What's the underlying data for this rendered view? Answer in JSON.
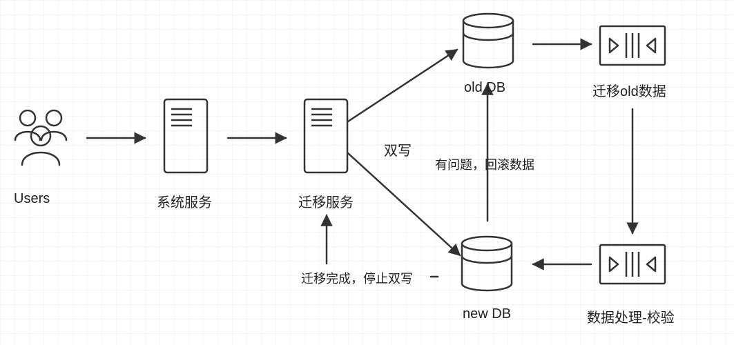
{
  "nodes": {
    "users": {
      "label": "Users"
    },
    "system_service": {
      "label": "系统服务"
    },
    "migration_service": {
      "label": "迁移服务"
    },
    "old_db": {
      "label": "old  DB"
    },
    "new_db": {
      "label": "new DB"
    },
    "migrate_old_data": {
      "label": "迁移old数据"
    },
    "data_process": {
      "label": "数据处理-校验"
    }
  },
  "edge_labels": {
    "dual_write": "双写",
    "rollback": "有问题，回滚数据",
    "migration_done": "迁移完成，停止双写"
  },
  "colors": {
    "stroke": "#333333"
  }
}
